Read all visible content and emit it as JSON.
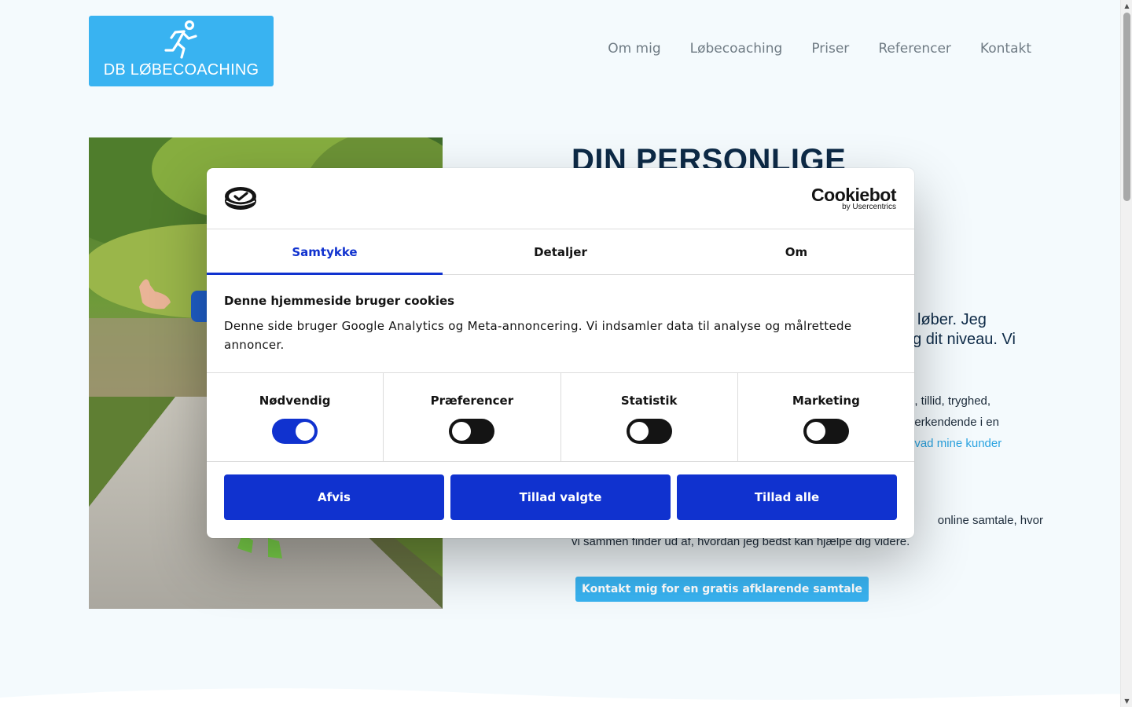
{
  "header": {
    "logo_text": "DB LØBECOACHING",
    "nav": [
      "Om mig",
      "Løbecoaching",
      "Priser",
      "Referencer",
      "Kontakt"
    ]
  },
  "hero": {
    "title": "DIN PERSONLIGE",
    "lead_end_1": "løber. Jeg",
    "lead_end_2": "og dit niveau. Vi",
    "body_frag_1": "d, tillid, tryghed,",
    "body_frag_2": "nerkendende i en",
    "body_link": "hvad mine kunder",
    "body2_line1": "online samtale, hvor",
    "body2_line2": "vi sammen finder ud af, hvordan jeg bedst kan hjælpe dig videre.",
    "cta_label": "Kontakt mig for en gratis afklarende samtale"
  },
  "cookie_dialog": {
    "brand_name": "Cookiebot",
    "brand_sub": "by Usercentrics",
    "tabs": [
      "Samtykke",
      "Detaljer",
      "Om"
    ],
    "active_tab": "Samtykke",
    "heading": "Denne hjemmeside bruger cookies",
    "description": "Denne side bruger Google Analytics og Meta-annoncering. Vi indsamler data til analyse og målrettede annoncer.",
    "toggles": [
      {
        "label": "Nødvendig",
        "on": true
      },
      {
        "label": "Præferencer",
        "on": false
      },
      {
        "label": "Statistik",
        "on": false
      },
      {
        "label": "Marketing",
        "on": false
      }
    ],
    "buttons": {
      "reject": "Afvis",
      "allow_selected": "Tillad valgte",
      "allow_all": "Tillad alle"
    }
  },
  "colors": {
    "page_bg": "#f4fafd",
    "brand_blue": "#39b3f1",
    "dialog_accent": "#1032cf",
    "heading_navy": "#0d2a47"
  },
  "icons": [
    "runner-logo-icon",
    "cookiebot-logo-icon",
    "scroll-up-arrow-icon",
    "scroll-down-arrow-icon"
  ]
}
